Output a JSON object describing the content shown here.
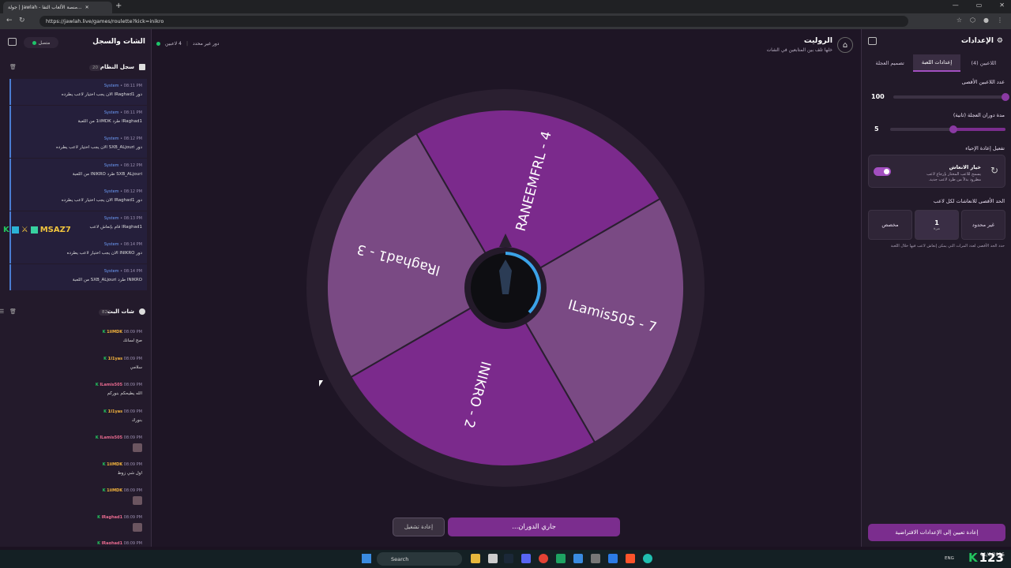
{
  "browser": {
    "tab_title": "جولة | Jawlah - منصة الألعاب التفا...",
    "url": "https://jawlah.live/games/roulette?kick=inikro"
  },
  "chat_panel": {
    "title": "الشات والسجل",
    "connection": "متصل",
    "system_log": {
      "title": "سجل النظام",
      "count": "20",
      "messages": [
        {
          "time": "08:11 PM",
          "sender": "System",
          "text": "دور lRaghad1 الان يجب اختيار لاعب يطرده"
        },
        {
          "time": "08:11 PM",
          "sender": "System",
          "text": "lRaghad1 طرد 1iiMDK من اللعبة"
        },
        {
          "time": "08:12 PM",
          "sender": "System",
          "text": "دور SXB_ALjouri الان يجب اختيار لاعب يطرده"
        },
        {
          "time": "08:12 PM",
          "sender": "System",
          "text": "SXB_ALjouri طرد INIKRO من اللعبة"
        },
        {
          "time": "08:12 PM",
          "sender": "System",
          "text": "دور lRaghad1 الان يجب اختيار لاعب يطرده"
        },
        {
          "time": "08:13 PM",
          "sender": "System",
          "text": "lRaghad1 قام بإنعاش لاعب"
        },
        {
          "time": "08:14 PM",
          "sender": "System",
          "text": "دور INIKRO الان يجب اختيار لاعب يطرده"
        },
        {
          "time": "08:14 PM",
          "sender": "System",
          "text": "INIKRO طرد SXB_ALjouri من اللعبة"
        }
      ]
    },
    "bot_chat": {
      "title": "شات البث",
      "count": "82",
      "messages": [
        {
          "time": "08:09 PM",
          "user": "1iiMDK",
          "text": "صح لسانك"
        },
        {
          "time": "08:09 PM",
          "user": "1I1yas",
          "text": "سلامي"
        },
        {
          "time": "08:09 PM",
          "user": "ILamis505",
          "text": "الله يطيحكم بنوركم"
        },
        {
          "time": "08:09 PM",
          "user": "1I1yas",
          "text": "بنورك"
        },
        {
          "time": "08:09 PM",
          "user": "ILamis505",
          "text": ""
        },
        {
          "time": "08:09 PM",
          "user": "1iiMDK",
          "text": "اول شي زوط"
        },
        {
          "time": "08:09 PM",
          "user": "1iiMDK",
          "text": ""
        },
        {
          "time": "08:09 PM",
          "user": "lRaghad1",
          "text": ""
        },
        {
          "time": "08:09 PM",
          "user": "lRaghad1",
          "text": ""
        }
      ]
    },
    "overlay_name": "MSAZ7"
  },
  "game": {
    "title": "الروليت",
    "subtitle": "خلها تلف بين المتابعين في الشات",
    "players_status": "4 لاعبين",
    "mode_status": "دور غير محدد",
    "wheel_segments": [
      {
        "label": "RANEEMFRL - 4",
        "color": "#7b2a8c"
      },
      {
        "label": "ILamis505 - 7",
        "color": "#7a4a84"
      },
      {
        "label": "INIKRO - 2",
        "color": "#7b2a8c"
      },
      {
        "label": "lRaghad1 - 3",
        "color": "#7a4a84"
      }
    ],
    "spin_button": "جاري الدوران...",
    "replay_button": "إعادة تشغيل"
  },
  "settings": {
    "title": "الإعدادات",
    "tabs": [
      "اللاعبين (4)",
      "إعدادات اللعبة",
      "تصميم العجلة"
    ],
    "active_tab": 1,
    "max_players_label": "عدد اللاعبين الأقصى",
    "max_players_value": "100",
    "max_players_fraction": 0.0,
    "spin_duration_label": "مدة دوران العجلة (ثانية)",
    "spin_duration_value": "5",
    "spin_duration_fraction": 0.45,
    "revive_section": "تفعيل إعادة الإحياء",
    "revive_option_title": "خيار الانعاش",
    "revive_option_desc": "يسمح للاعب المختار بإرجاع لاعب مطرود بدلاً من طرد لاعب جديد.",
    "revive_max_label": "الحد الأقصى للانعاشات لكل لاعب",
    "revive_options": [
      "غير محدود",
      "1",
      "مخصص"
    ],
    "revive_selected_sub": "مرة",
    "revive_note": "حدد الحد الأقصى لعدد المرات التي يمكن إنعاش لاعب فيها خلال اللعبة",
    "reset_button": "إعادة تعيين إلى الإعدادات الافتراضية"
  },
  "taskbar": {
    "search": "Search",
    "lang": "ENG",
    "time": "11/6/2025",
    "badge": "123"
  }
}
